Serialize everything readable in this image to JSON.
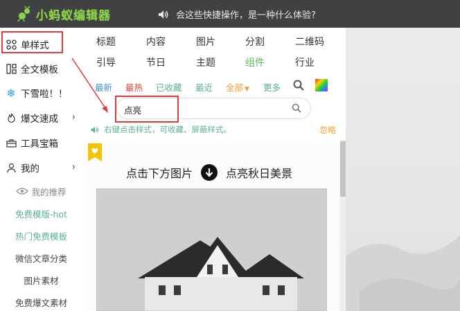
{
  "header": {
    "logo_text": "小蚂蚁编辑器",
    "notice": "会这些快捷操作，是一种什么体验?"
  },
  "sidebar": {
    "items": [
      {
        "label": "单样式",
        "icon": "grid-icon"
      },
      {
        "label": "全文模板",
        "icon": "template-icon"
      },
      {
        "label": "下雪啦！！",
        "icon": "snowflake-icon"
      },
      {
        "label": "爆文速成",
        "icon": "fire-icon",
        "chevron": "›"
      },
      {
        "label": "工具宝箱",
        "icon": "toolbox-icon"
      },
      {
        "label": "我的",
        "icon": "user-icon",
        "chevron": "›"
      }
    ],
    "sub_items": [
      {
        "label": "我的推荐",
        "icon": "eye-icon"
      },
      {
        "label": "免费模版-hot"
      },
      {
        "label": "热门免费模板"
      },
      {
        "label": "微信文章分类"
      },
      {
        "label": "图片素材"
      },
      {
        "label": "免费爆文素材"
      }
    ]
  },
  "panel": {
    "categories_row1": [
      "标题",
      "内容",
      "图片",
      "分割",
      "二维码"
    ],
    "categories_row2": [
      "引导",
      "节日",
      "主题",
      "组件",
      "行业"
    ],
    "active_category": "组件",
    "filters": [
      {
        "label": "最新",
        "color": "#4a90c8"
      },
      {
        "label": "最热",
        "color": "#e0463c"
      },
      {
        "label": "已收藏",
        "color": "#5bb28f"
      },
      {
        "label": "最近",
        "color": "#5bb28f"
      },
      {
        "label": "全部",
        "color": "#f0a030"
      },
      {
        "label": "更多",
        "color": "#5bb28f"
      }
    ],
    "search_value": "点亮",
    "hint": "右键点击样式，可收藏、屏蔽样式。",
    "ignore_label": "忽略",
    "preview_text_left": "点击下方图片",
    "preview_text_right": "点亮秋日美景"
  },
  "colors": {
    "accent_green": "#5cb85c",
    "highlight_red": "#e23b3b",
    "topbar": "#3f4143"
  }
}
